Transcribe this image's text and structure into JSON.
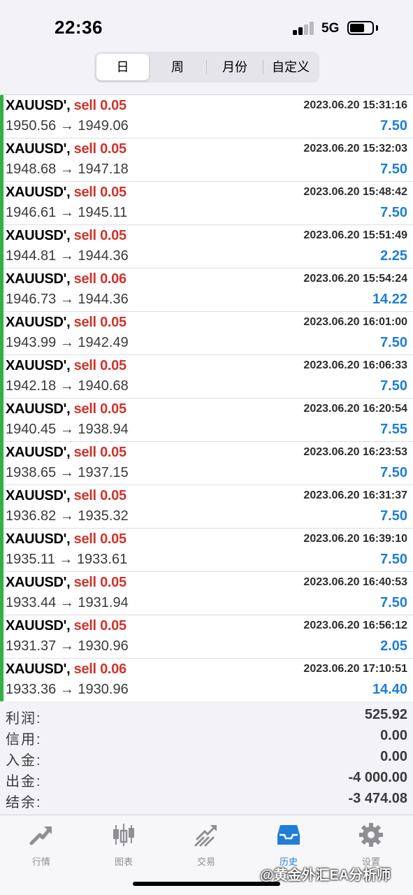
{
  "status_bar": {
    "time": "22:36",
    "network": "5G"
  },
  "segments": [
    "日",
    "周",
    "月份",
    "自定义"
  ],
  "deals": [
    {
      "symbol": "XAUUSD'",
      "type": "sell",
      "volume": "0.05",
      "time": "2023.06.20 15:31:16",
      "open_price": "1950.56",
      "close_price": "1949.06",
      "profit": "7.50"
    },
    {
      "symbol": "XAUUSD'",
      "type": "sell",
      "volume": "0.05",
      "time": "2023.06.20 15:32:03",
      "open_price": "1948.68",
      "close_price": "1947.18",
      "profit": "7.50"
    },
    {
      "symbol": "XAUUSD'",
      "type": "sell",
      "volume": "0.05",
      "time": "2023.06.20 15:48:42",
      "open_price": "1946.61",
      "close_price": "1945.11",
      "profit": "7.50"
    },
    {
      "symbol": "XAUUSD'",
      "type": "sell",
      "volume": "0.05",
      "time": "2023.06.20 15:51:49",
      "open_price": "1944.81",
      "close_price": "1944.36",
      "profit": "2.25"
    },
    {
      "symbol": "XAUUSD'",
      "type": "sell",
      "volume": "0.06",
      "time": "2023.06.20 15:54:24",
      "open_price": "1946.73",
      "close_price": "1944.36",
      "profit": "14.22"
    },
    {
      "symbol": "XAUUSD'",
      "type": "sell",
      "volume": "0.05",
      "time": "2023.06.20 16:01:00",
      "open_price": "1943.99",
      "close_price": "1942.49",
      "profit": "7.50"
    },
    {
      "symbol": "XAUUSD'",
      "type": "sell",
      "volume": "0.05",
      "time": "2023.06.20 16:06:33",
      "open_price": "1942.18",
      "close_price": "1940.68",
      "profit": "7.50"
    },
    {
      "symbol": "XAUUSD'",
      "type": "sell",
      "volume": "0.05",
      "time": "2023.06.20 16:20:54",
      "open_price": "1940.45",
      "close_price": "1938.94",
      "profit": "7.55"
    },
    {
      "symbol": "XAUUSD'",
      "type": "sell",
      "volume": "0.05",
      "time": "2023.06.20 16:23:53",
      "open_price": "1938.65",
      "close_price": "1937.15",
      "profit": "7.50"
    },
    {
      "symbol": "XAUUSD'",
      "type": "sell",
      "volume": "0.05",
      "time": "2023.06.20 16:31:37",
      "open_price": "1936.82",
      "close_price": "1935.32",
      "profit": "7.50"
    },
    {
      "symbol": "XAUUSD'",
      "type": "sell",
      "volume": "0.05",
      "time": "2023.06.20 16:39:10",
      "open_price": "1935.11",
      "close_price": "1933.61",
      "profit": "7.50"
    },
    {
      "symbol": "XAUUSD'",
      "type": "sell",
      "volume": "0.05",
      "time": "2023.06.20 16:40:53",
      "open_price": "1933.44",
      "close_price": "1931.94",
      "profit": "7.50"
    },
    {
      "symbol": "XAUUSD'",
      "type": "sell",
      "volume": "0.05",
      "time": "2023.06.20 16:56:12",
      "open_price": "1931.37",
      "close_price": "1930.96",
      "profit": "2.05"
    },
    {
      "symbol": "XAUUSD'",
      "type": "sell",
      "volume": "0.06",
      "time": "2023.06.20 17:10:51",
      "open_price": "1933.36",
      "close_price": "1930.96",
      "profit": "14.40"
    }
  ],
  "summary": [
    {
      "label": "利润:",
      "value": "525.92"
    },
    {
      "label": "信用:",
      "value": "0.00"
    },
    {
      "label": "入金:",
      "value": "0.00"
    },
    {
      "label": "出金:",
      "value": "-4 000.00"
    },
    {
      "label": "结余:",
      "value": "-3 474.08"
    }
  ],
  "tabbar": [
    {
      "label": "行情",
      "icon": "quotes-icon",
      "active": false
    },
    {
      "label": "图表",
      "icon": "chart-icon",
      "active": false
    },
    {
      "label": "交易",
      "icon": "trade-icon",
      "active": false
    },
    {
      "label": "历史",
      "icon": "history-icon",
      "active": true
    },
    {
      "label": "设置",
      "icon": "settings-icon",
      "active": false
    }
  ],
  "watermark": "@黄金外汇EA分析师",
  "colors": {
    "accent": "#1e7ed8",
    "sell": "#d0342c",
    "stripe": "#32b043"
  }
}
